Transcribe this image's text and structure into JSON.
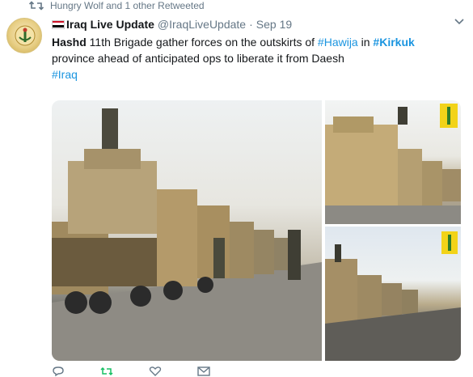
{
  "retweet": {
    "icon": "retweet-icon",
    "text": "Hungry Wolf and 1 other Retweeted"
  },
  "tweet": {
    "avatar": "hashd-emblem-avatar",
    "flag": "iraq-flag-emoji",
    "display_name": "Iraq Live Update",
    "handle": "@IraqLiveUpdate",
    "separator": "·",
    "date": "Sep 19",
    "text": {
      "lead": "Hashd",
      "part1": " 11th Brigade gather forces on the outskirts of ",
      "hashtag_hawija": "#Hawija",
      "part2": " in ",
      "hashtag_kirkuk": "#Kirkuk",
      "part3": " province ahead of anticipated ops to liberate it from Daesh",
      "hashtag_iraq": "#Iraq"
    },
    "media": [
      {
        "name": "photo-main",
        "description": "Military convoy with tank on flatbed trucks along road"
      },
      {
        "name": "photo-top-right",
        "description": "Convoy of armored trucks with Hashd logo"
      },
      {
        "name": "photo-bottom-right",
        "description": "Convoy on road with Hashd logo"
      }
    ]
  },
  "actions": {
    "reply_icon": "reply-icon",
    "retweet_icon": "retweet-icon",
    "like_icon": "heart-icon",
    "dm_icon": "envelope-icon"
  },
  "colors": {
    "link": "#1b95e0",
    "muted": "#657786",
    "text": "#14171a"
  }
}
